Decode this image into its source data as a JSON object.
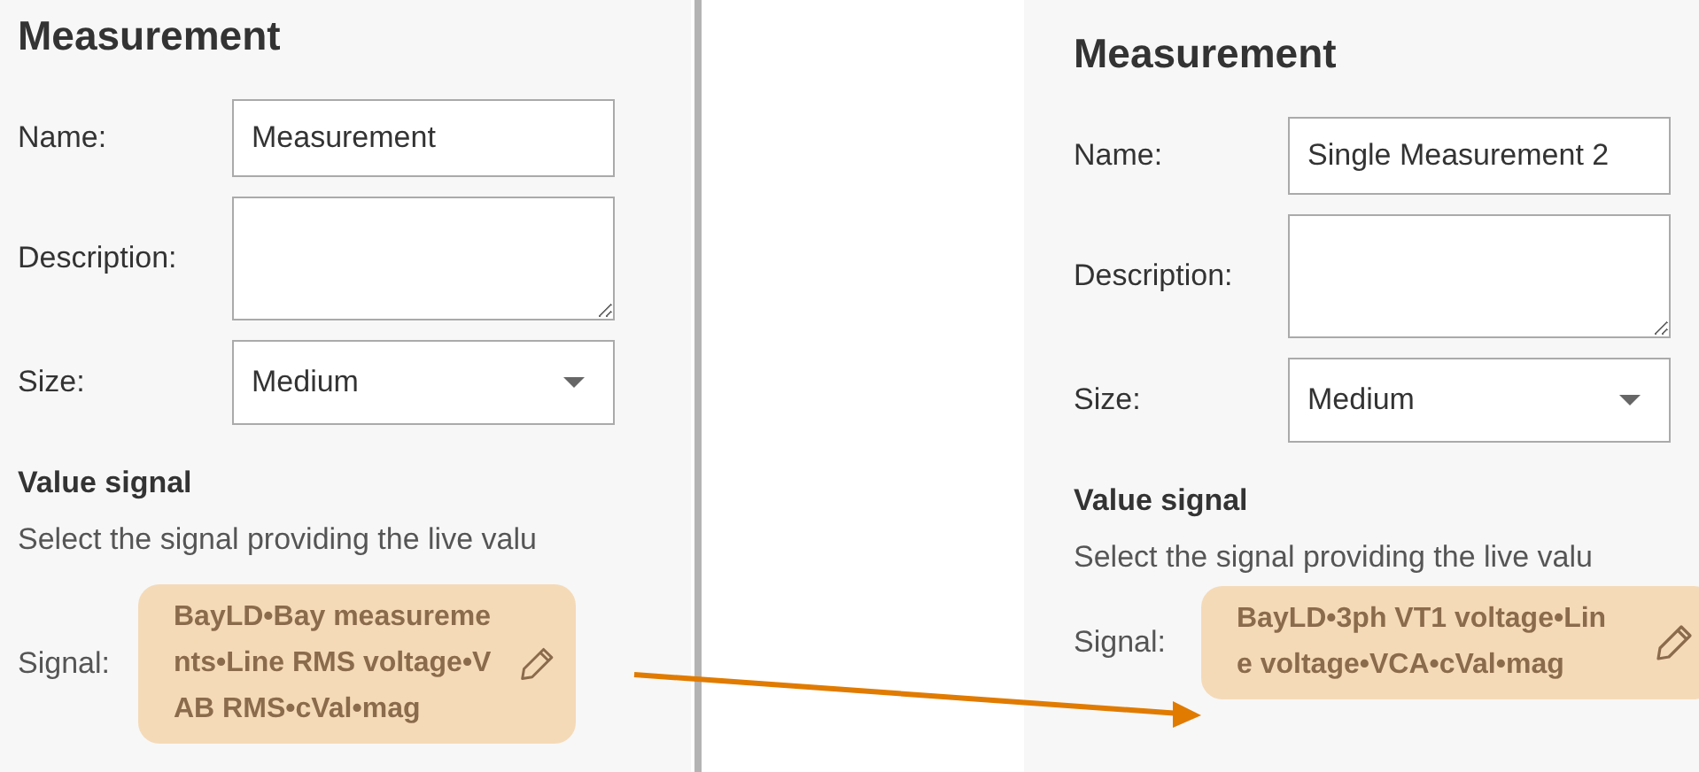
{
  "panels": [
    {
      "title": "Measurement",
      "fields": [
        {
          "label": "Name:",
          "kind": "text",
          "value": "Measurement"
        },
        {
          "label": "Description:",
          "kind": "textarea"
        },
        {
          "label": "Size:",
          "kind": "select",
          "value": "Medium"
        }
      ],
      "section_title": "Value signal",
      "section_description": "Select the signal providing the live valu",
      "signal_label": "Signal:",
      "signal_value": "BayLD•Bay measurements•Line RMS voltage•VAB RMS•cVal•mag"
    },
    {
      "title": "Measurement",
      "fields": [
        {
          "label": "Name:",
          "kind": "text",
          "value": "Single Measurement 2"
        },
        {
          "label": "Description:",
          "kind": "textarea"
        },
        {
          "label": "Size:",
          "kind": "select",
          "value": "Medium"
        }
      ],
      "section_title": "Value signal",
      "section_description": "Select the signal providing the live valu",
      "signal_label": "Signal:",
      "signal_value": "BayLD•3ph VT1 voltage•Line voltage•VCA•cVal•mag"
    }
  ]
}
